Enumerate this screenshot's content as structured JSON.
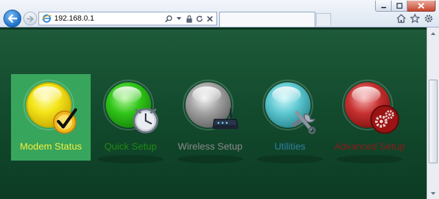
{
  "browser": {
    "url": "192.168.0.1",
    "window_controls": {
      "minimize_icon": "minimize-icon",
      "maximize_icon": "maximize-icon",
      "close_icon": "close-icon"
    },
    "address_tools": [
      "search-icon",
      "dropdown-icon",
      "lock-icon",
      "refresh-icon",
      "stop-icon"
    ],
    "right_tools": [
      "home-icon",
      "favorites-star-icon",
      "settings-gear-icon"
    ]
  },
  "menu": {
    "items": [
      {
        "label": "Modem Status",
        "color": "#f5ee3a",
        "icon": "checkmark-icon",
        "active": true
      },
      {
        "label": "Quick Setup",
        "color": "#1f8a12",
        "icon": "clock-icon",
        "active": false
      },
      {
        "label": "Wireless Setup",
        "color": "#8a8a8a",
        "icon": "router-icon",
        "active": false
      },
      {
        "label": "Utilities",
        "color": "#2f7fa0",
        "icon": "wrench-icon",
        "active": false
      },
      {
        "label": "Advanced Setup",
        "color": "#8a1a1a",
        "icon": "gears-icon",
        "active": false
      }
    ]
  },
  "colors": {
    "page_bg": "#134b2e",
    "active_bg": "#38a55d"
  }
}
